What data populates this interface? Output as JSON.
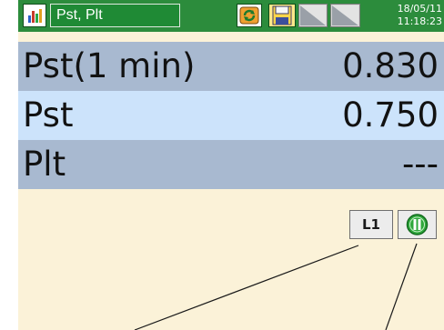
{
  "titlebar": {
    "title": "Pst, Plt",
    "date": "18/05/11",
    "time": "11:18:23",
    "icons": [
      "chart-app-icon",
      "sync-icon",
      "save-icon",
      "nav-prev-icon",
      "nav-next-icon"
    ]
  },
  "rows": [
    {
      "label": "Pst(1 min)",
      "value": "0.830"
    },
    {
      "label": "Pst",
      "value": "0.750"
    },
    {
      "label": "Plt",
      "value": "---"
    }
  ],
  "buttons": {
    "l1_label": "L1",
    "pause_icon": "pause-icon"
  },
  "colors": {
    "titlebar": "#2c8c3c",
    "row_dark": "#a8b9d0",
    "row_light": "#cce3fb",
    "background": "#fbf2d8"
  }
}
